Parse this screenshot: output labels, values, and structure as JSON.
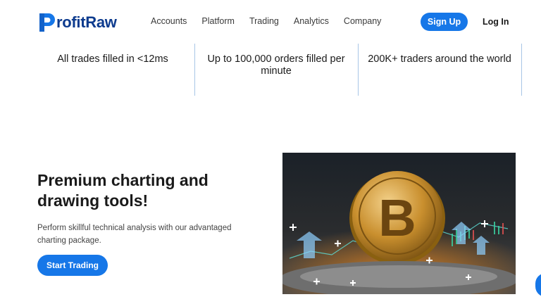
{
  "header": {
    "logo_text": "rofitRaw",
    "logo_letter": "P",
    "nav": [
      {
        "label": "Accounts"
      },
      {
        "label": "Platform"
      },
      {
        "label": "Trading"
      },
      {
        "label": "Analytics"
      },
      {
        "label": "Company"
      }
    ],
    "signup_label": "Sign Up",
    "login_label": "Log In"
  },
  "stats": [
    {
      "text": "All trades filled in <12ms"
    },
    {
      "text": "Up to 100,000 orders filled per minute"
    },
    {
      "text": "200K+ traders around the world"
    }
  ],
  "hero": {
    "title": "Premium charting and drawing tools!",
    "description": "Perform skillful technical analysis with our advantaged charting package.",
    "cta_label": "Start Trading",
    "image_icon": "bitcoin-coin-image"
  },
  "colors": {
    "brand_blue": "#1677e8",
    "logo_navy": "#0d3b8e",
    "divider": "#a8c6e6"
  }
}
